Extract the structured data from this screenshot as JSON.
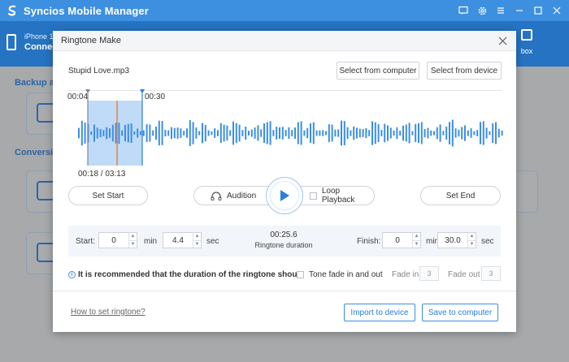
{
  "app": {
    "title": "Syncios Mobile Manager",
    "accent": "#3d8fe0",
    "icons": [
      "message-icon",
      "gear-icon",
      "menu-icon",
      "minimize-icon",
      "maximize-icon",
      "close-icon"
    ]
  },
  "background": {
    "device_name": "iPhone 1",
    "device_status": "Connect",
    "toolbox_label": "box",
    "sections": [
      "Backup an",
      "Conversion"
    ]
  },
  "dialog": {
    "title": "Ringtone Make",
    "file_name": "Stupid Love.mp3",
    "select_computer": "Select from computer",
    "select_device": "Select from device",
    "waveform": {
      "start_marker": "00:04",
      "end_marker": "00:30",
      "position": "00:18 / 03:13",
      "selection_color": "#bfdbf7",
      "wave_color": "#3b8ee6",
      "playhead_color": "#e8833a"
    },
    "set_start": "Set Start",
    "set_end": "Set End",
    "audition": "Audition",
    "loop_playback": "Loop Playback",
    "start_label": "Start:",
    "start_min": "0",
    "start_sec": "4.4",
    "min_unit": "min",
    "sec_unit": "sec",
    "duration_value": "00:25.6",
    "duration_label": "Ringtone duration",
    "finish_label": "Finish:",
    "finish_min": "0",
    "finish_sec": "30.0",
    "tip": "It is recommended that the duration of the ringtone shou...",
    "tone_fade": "Tone fade in and out",
    "fade_in_label": "Fade in",
    "fade_in_value": "3",
    "fade_out_label": "Fade out",
    "fade_out_value": "3",
    "help_link": "How to set ringtone?",
    "import_button": "Import to device",
    "save_button": "Save to computer"
  }
}
